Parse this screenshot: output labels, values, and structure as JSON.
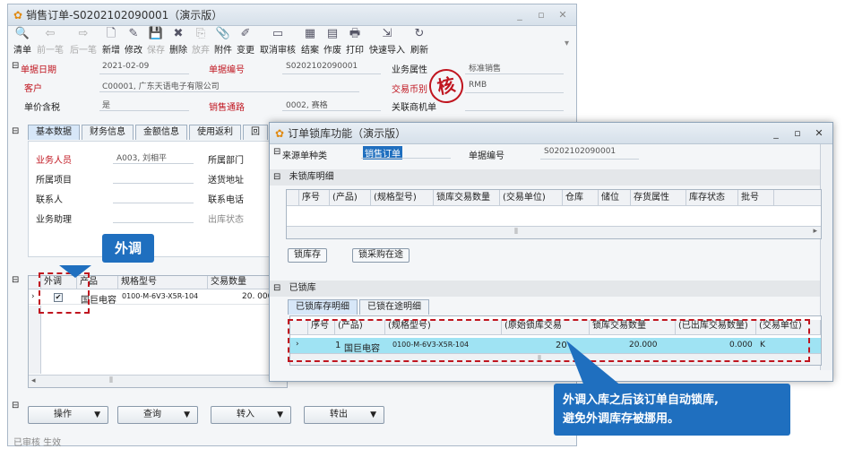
{
  "main": {
    "title": "销售订单-S0202102090001（演示版）",
    "toolbar": [
      {
        "label": "清单",
        "icon": "search-icon",
        "glyph": "🔍"
      },
      {
        "label": "前一笔",
        "icon": "arrow-left-icon",
        "glyph": "⇦",
        "disabled": true
      },
      {
        "label": "后一笔",
        "icon": "arrow-right-icon",
        "glyph": "⇨",
        "disabled": true
      },
      {
        "label": "新增",
        "icon": "new-doc-icon",
        "glyph": "🗋"
      },
      {
        "label": "修改",
        "icon": "edit-icon",
        "glyph": "✎"
      },
      {
        "label": "保存",
        "icon": "save-icon",
        "glyph": "💾",
        "disabled": true
      },
      {
        "label": "删除",
        "icon": "delete-icon",
        "glyph": "✖"
      },
      {
        "label": "放弃",
        "icon": "discard-icon",
        "glyph": "⎘",
        "disabled": true
      },
      {
        "label": "附件",
        "icon": "attach-icon",
        "glyph": "📎"
      },
      {
        "label": "变更",
        "icon": "change-icon",
        "glyph": "✐"
      },
      {
        "label": "取消审核",
        "icon": "unaudit-icon",
        "glyph": "▭"
      },
      {
        "label": "结案",
        "icon": "close-case-icon",
        "glyph": "▦"
      },
      {
        "label": "作废",
        "icon": "void-icon",
        "glyph": "▤"
      },
      {
        "label": "打印",
        "icon": "print-icon",
        "glyph": "🖶"
      },
      {
        "label": "快速导入",
        "icon": "import-icon",
        "glyph": "⇲"
      },
      {
        "label": "刷新",
        "icon": "refresh-icon",
        "glyph": "↻"
      }
    ],
    "header": {
      "doc_date_label": "单据日期",
      "doc_date": "2021-02-09",
      "doc_no_label": "单据编号",
      "doc_no": "S0202102090001",
      "biz_attr_label": "业务属性",
      "biz_attr": "标准销售",
      "customer_label": "客户",
      "customer": "C00001, 广东天语电子有限公司",
      "currency_label": "交易币别",
      "currency": "RMB",
      "tax_label": "单价含税",
      "tax": "是",
      "channel_label": "销售通路",
      "channel": "0002, 赛格",
      "related_label": "关联商机单"
    },
    "tabs": [
      "基本数据",
      "财务信息",
      "金额信息",
      "使用返利",
      "回"
    ],
    "basic": {
      "sales_label": "业务人员",
      "sales": "A003, 刘相平",
      "dept_label": "所属部门",
      "project_label": "所属项目",
      "ship_label": "送货地址",
      "contact_label": "联系人",
      "phone_label": "联系电话",
      "assistant_label": "业务助理",
      "out_status_label": "出库状态"
    },
    "grid": {
      "headers": [
        "外调",
        "产品",
        "规格型号",
        "交易数量"
      ],
      "row": {
        "product": "国巨电容",
        "spec": "0100-M-6V3-X5R-104",
        "qty": "20. 000"
      }
    },
    "buttons": [
      "操作",
      "查询",
      "转入",
      "转出"
    ],
    "status": "已审核 生效"
  },
  "sub": {
    "title": "订单锁库功能（演示版）",
    "source_label": "来源单种类",
    "source": "销售订单",
    "doc_no_label": "单据编号",
    "doc_no": "S0202102090001",
    "unlocked_title": "未锁库明细",
    "unlocked_headers": [
      "序号",
      "(产品)",
      "(规格型号)",
      "锁库交易数量",
      "(交易单位)",
      "仓库",
      "储位",
      "存货属性",
      "库存状态",
      "批号"
    ],
    "btn_lock": "锁库存",
    "btn_lock_purchase": "锁采购在途",
    "locked_title": "已锁库",
    "locked_tabs": [
      "已锁库存明细",
      "已锁在途明细"
    ],
    "locked_headers": [
      "序号",
      "(产品)",
      "(规格型号)",
      "(原始锁库交易",
      "锁库交易数量",
      "(已出库交易数量)",
      "(交易单位)"
    ],
    "locked_row": {
      "seq": "1",
      "product": "国巨电容",
      "spec": "0100-M-6V3-X5R-104",
      "orig": "20",
      "qty": "20.000",
      "out": "0.000",
      "unit": "K"
    }
  },
  "annotations": {
    "label_waidiao": "外调",
    "stamp_text": "核",
    "note_line1": "外调入库之后该订单自动锁库,",
    "note_line2": "避免外调库存被挪用。"
  }
}
